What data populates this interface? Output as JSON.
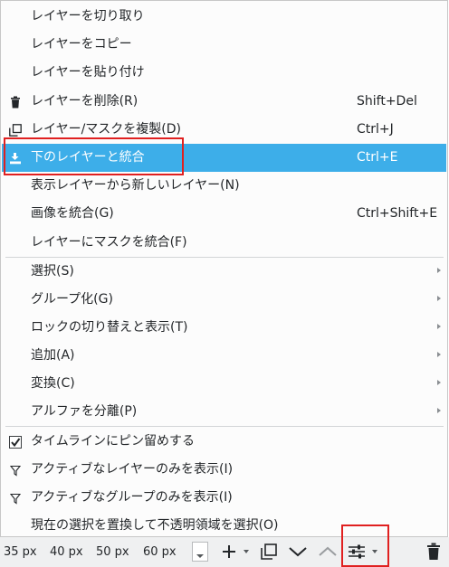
{
  "menu": {
    "items": [
      {
        "label": "レイヤーを切り取り",
        "shortcut": ""
      },
      {
        "label": "レイヤーをコピー",
        "shortcut": ""
      },
      {
        "label": "レイヤーを貼り付け",
        "shortcut": ""
      },
      {
        "label": "レイヤーを削除(R)",
        "shortcut": "Shift+Del",
        "icon": "trash-icon"
      },
      {
        "label": "レイヤー/マスクを複製(D)",
        "shortcut": "Ctrl+J",
        "icon": "duplicate-icon"
      },
      {
        "label": "下のレイヤーと統合",
        "shortcut": "Ctrl+E",
        "icon": "merge-down-icon",
        "highlighted": true
      },
      {
        "label": "表示レイヤーから新しいレイヤー(N)",
        "shortcut": ""
      },
      {
        "label": "画像を統合(G)",
        "shortcut": "Ctrl+Shift+E"
      },
      {
        "label": "レイヤーにマスクを統合(F)",
        "shortcut": ""
      }
    ],
    "submenus": [
      {
        "label": "選択(S)"
      },
      {
        "label": "グループ化(G)"
      },
      {
        "label": "ロックの切り替えと表示(T)"
      },
      {
        "label": "追加(A)"
      },
      {
        "label": "変換(C)"
      },
      {
        "label": "アルファを分離(P)"
      }
    ],
    "options": [
      {
        "label": "タイムラインにピン留めする",
        "icon": "checkbox-checked-icon",
        "checked": true
      },
      {
        "label": "アクティブなレイヤーのみを表示(I)",
        "icon": "filter-icon"
      },
      {
        "label": "アクティブなグループのみを表示(I)",
        "icon": "filter-icon"
      },
      {
        "label": "現在の選択を置換して不透明領域を選択(O)",
        "icon": ""
      }
    ]
  },
  "toolbar": {
    "thumb_sizes": [
      "35 px",
      "40 px",
      "50 px",
      "60 px"
    ],
    "buttons": [
      "add-layer-icon",
      "dropdown-icon",
      "duplicate-icon",
      "move-down-icon",
      "move-up-icon",
      "properties-icon",
      "dropdown-icon",
      "trash-icon"
    ]
  },
  "colors": {
    "highlight": "#3daee9",
    "annotation_red": "#e02020",
    "menu_bg": "#fcfcfc",
    "toolbar_bg": "#eff0f1",
    "text": "#232629"
  }
}
